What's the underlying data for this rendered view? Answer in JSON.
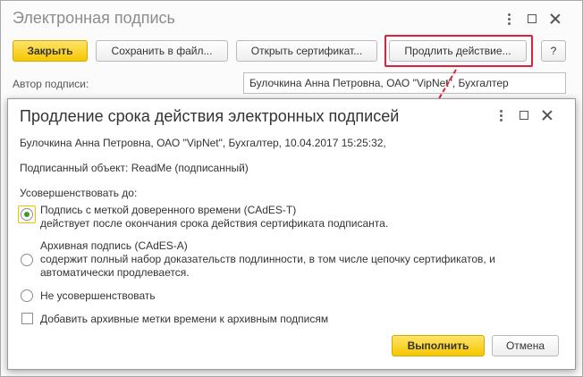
{
  "outer": {
    "title": "Электронная подпись",
    "buttons": {
      "close": "Закрыть",
      "save": "Сохранить в файл...",
      "open_cert": "Открыть сертификат...",
      "extend": "Продлить действие...",
      "help": "?"
    },
    "author_label": "Автор подписи:",
    "author_value": "Булочкина Анна Петровна, ОАО \"VipNet\", Бухгалтер"
  },
  "dialog": {
    "title": "Продление срока действия электронных подписей",
    "signer_line": "Булочкина Анна Петровна, ОАО \"VipNet\", Бухгалтер, 10.04.2017 15:25:32,",
    "signed_object_label": "Подписанный объект:",
    "signed_object_value": "ReadMe (подписанный)",
    "improve_label": "Усовершенствовать до:",
    "options": [
      {
        "title": "Подпись с меткой доверенного времени (CAdES-T)",
        "desc": "действует после окончания срока действия сертификата подписанта.",
        "checked": true
      },
      {
        "title": "Архивная подпись (CAdES-A)",
        "desc": "содержит полный набор доказательств подлинности, в том числе цепочку сертификатов, и",
        "desc2": "автоматически продлевается.",
        "checked": false
      },
      {
        "title": "Не усовершенствовать",
        "checked": false
      }
    ],
    "checkbox_label": "Добавить архивные метки времени к архивным подписям",
    "checkbox_checked": false,
    "buttons": {
      "execute": "Выполнить",
      "cancel": "Отмена"
    }
  },
  "colors": {
    "accent_yellow": "#f5c700",
    "highlight_red": "#e0203a",
    "radio_green": "#3d9a2e"
  }
}
